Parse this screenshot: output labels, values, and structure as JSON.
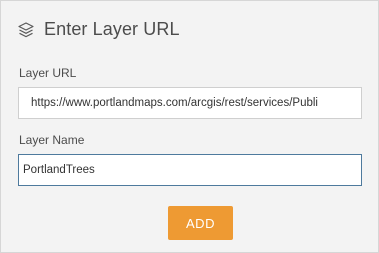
{
  "dialog": {
    "title": "Enter Layer URL",
    "icon": "layers-icon"
  },
  "layer_url": {
    "label": "Layer URL",
    "value": "https://www.portlandmaps.com/arcgis/rest/services/Publi"
  },
  "layer_name": {
    "label": "Layer Name",
    "value": "PortlandTrees"
  },
  "actions": {
    "add_label": "ADD",
    "add_color": "#ee9a33"
  }
}
